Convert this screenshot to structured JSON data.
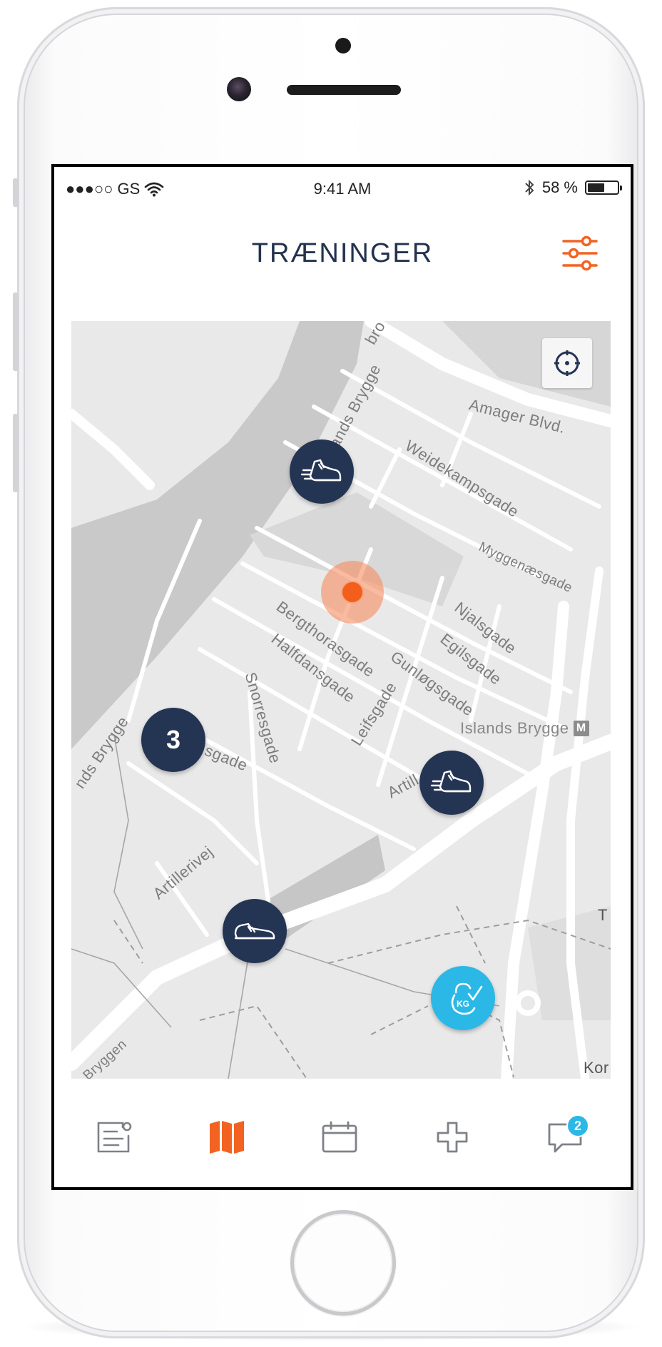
{
  "status_bar": {
    "carrier": "●●●○○ GS",
    "time": "9:41 AM",
    "battery_text": "58 %",
    "battery_level": 0.58
  },
  "header": {
    "title": "TRÆNINGER"
  },
  "map": {
    "streets": {
      "bro": "bro",
      "islands_brygge_top": "lands Brygge",
      "amager_blvd": "Amager Blvd.",
      "weidekampsgade": "Weidekampsgade",
      "myggenaesgade": "Myggenæsgade",
      "njalsgade": "Njalsgade",
      "egilsgade": "Egilsgade",
      "gunloegsgade": "Gunløgsgade",
      "bergthorasgade": "Bergthorasgade",
      "halfdansgade": "Halfdansgade",
      "leifsgade": "Leifsgade",
      "snorresgade": "Snorresgade",
      "islands_brygge_left": "nds Brygge",
      "sgade": "sgade",
      "artill": "Artill",
      "artillerivej": "Artillerivej",
      "bryggen": "Bryggen",
      "kor": "Kor",
      "t": "T"
    },
    "metro_station": "Islands Brygge",
    "metro_symbol": "M",
    "cluster_count": "3"
  },
  "tab_bar": {
    "messages_badge": "2"
  },
  "colors": {
    "accent": "#f26322",
    "navy": "#243453",
    "cyan": "#2cb8e6"
  }
}
